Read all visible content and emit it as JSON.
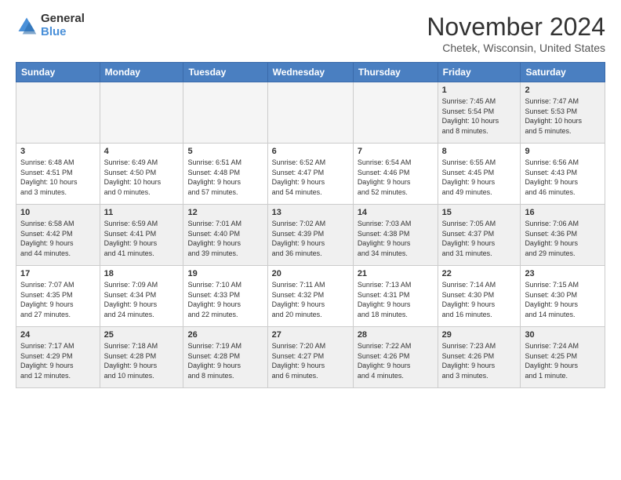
{
  "logo": {
    "general": "General",
    "blue": "Blue"
  },
  "title": "November 2024",
  "location": "Chetek, Wisconsin, United States",
  "days_of_week": [
    "Sunday",
    "Monday",
    "Tuesday",
    "Wednesday",
    "Thursday",
    "Friday",
    "Saturday"
  ],
  "weeks": [
    [
      {
        "day": "",
        "info": "",
        "empty": true
      },
      {
        "day": "",
        "info": "",
        "empty": true
      },
      {
        "day": "",
        "info": "",
        "empty": true
      },
      {
        "day": "",
        "info": "",
        "empty": true
      },
      {
        "day": "",
        "info": "",
        "empty": true
      },
      {
        "day": "1",
        "info": "Sunrise: 7:45 AM\nSunset: 5:54 PM\nDaylight: 10 hours\nand 8 minutes."
      },
      {
        "day": "2",
        "info": "Sunrise: 7:47 AM\nSunset: 5:53 PM\nDaylight: 10 hours\nand 5 minutes."
      }
    ],
    [
      {
        "day": "3",
        "info": "Sunrise: 6:48 AM\nSunset: 4:51 PM\nDaylight: 10 hours\nand 3 minutes."
      },
      {
        "day": "4",
        "info": "Sunrise: 6:49 AM\nSunset: 4:50 PM\nDaylight: 10 hours\nand 0 minutes."
      },
      {
        "day": "5",
        "info": "Sunrise: 6:51 AM\nSunset: 4:48 PM\nDaylight: 9 hours\nand 57 minutes."
      },
      {
        "day": "6",
        "info": "Sunrise: 6:52 AM\nSunset: 4:47 PM\nDaylight: 9 hours\nand 54 minutes."
      },
      {
        "day": "7",
        "info": "Sunrise: 6:54 AM\nSunset: 4:46 PM\nDaylight: 9 hours\nand 52 minutes."
      },
      {
        "day": "8",
        "info": "Sunrise: 6:55 AM\nSunset: 4:45 PM\nDaylight: 9 hours\nand 49 minutes."
      },
      {
        "day": "9",
        "info": "Sunrise: 6:56 AM\nSunset: 4:43 PM\nDaylight: 9 hours\nand 46 minutes."
      }
    ],
    [
      {
        "day": "10",
        "info": "Sunrise: 6:58 AM\nSunset: 4:42 PM\nDaylight: 9 hours\nand 44 minutes."
      },
      {
        "day": "11",
        "info": "Sunrise: 6:59 AM\nSunset: 4:41 PM\nDaylight: 9 hours\nand 41 minutes."
      },
      {
        "day": "12",
        "info": "Sunrise: 7:01 AM\nSunset: 4:40 PM\nDaylight: 9 hours\nand 39 minutes."
      },
      {
        "day": "13",
        "info": "Sunrise: 7:02 AM\nSunset: 4:39 PM\nDaylight: 9 hours\nand 36 minutes."
      },
      {
        "day": "14",
        "info": "Sunrise: 7:03 AM\nSunset: 4:38 PM\nDaylight: 9 hours\nand 34 minutes."
      },
      {
        "day": "15",
        "info": "Sunrise: 7:05 AM\nSunset: 4:37 PM\nDaylight: 9 hours\nand 31 minutes."
      },
      {
        "day": "16",
        "info": "Sunrise: 7:06 AM\nSunset: 4:36 PM\nDaylight: 9 hours\nand 29 minutes."
      }
    ],
    [
      {
        "day": "17",
        "info": "Sunrise: 7:07 AM\nSunset: 4:35 PM\nDaylight: 9 hours\nand 27 minutes."
      },
      {
        "day": "18",
        "info": "Sunrise: 7:09 AM\nSunset: 4:34 PM\nDaylight: 9 hours\nand 24 minutes."
      },
      {
        "day": "19",
        "info": "Sunrise: 7:10 AM\nSunset: 4:33 PM\nDaylight: 9 hours\nand 22 minutes."
      },
      {
        "day": "20",
        "info": "Sunrise: 7:11 AM\nSunset: 4:32 PM\nDaylight: 9 hours\nand 20 minutes."
      },
      {
        "day": "21",
        "info": "Sunrise: 7:13 AM\nSunset: 4:31 PM\nDaylight: 9 hours\nand 18 minutes."
      },
      {
        "day": "22",
        "info": "Sunrise: 7:14 AM\nSunset: 4:30 PM\nDaylight: 9 hours\nand 16 minutes."
      },
      {
        "day": "23",
        "info": "Sunrise: 7:15 AM\nSunset: 4:30 PM\nDaylight: 9 hours\nand 14 minutes."
      }
    ],
    [
      {
        "day": "24",
        "info": "Sunrise: 7:17 AM\nSunset: 4:29 PM\nDaylight: 9 hours\nand 12 minutes."
      },
      {
        "day": "25",
        "info": "Sunrise: 7:18 AM\nSunset: 4:28 PM\nDaylight: 9 hours\nand 10 minutes."
      },
      {
        "day": "26",
        "info": "Sunrise: 7:19 AM\nSunset: 4:28 PM\nDaylight: 9 hours\nand 8 minutes."
      },
      {
        "day": "27",
        "info": "Sunrise: 7:20 AM\nSunset: 4:27 PM\nDaylight: 9 hours\nand 6 minutes."
      },
      {
        "day": "28",
        "info": "Sunrise: 7:22 AM\nSunset: 4:26 PM\nDaylight: 9 hours\nand 4 minutes."
      },
      {
        "day": "29",
        "info": "Sunrise: 7:23 AM\nSunset: 4:26 PM\nDaylight: 9 hours\nand 3 minutes."
      },
      {
        "day": "30",
        "info": "Sunrise: 7:24 AM\nSunset: 4:25 PM\nDaylight: 9 hours\nand 1 minute."
      }
    ]
  ]
}
